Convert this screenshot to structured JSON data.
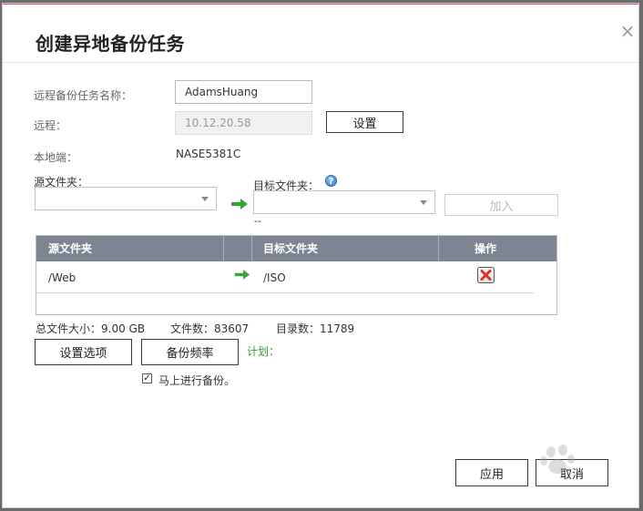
{
  "dialog": {
    "title": "创建异地备份任务",
    "close_symbol": "×"
  },
  "form": {
    "task_name_label": "远程备份任务名称：",
    "task_name_value": "AdamsHuang",
    "remote_label": "远程：",
    "remote_value": "10.12.20.58",
    "settings_button": "设置",
    "local_label": "本地端：",
    "local_value": "NASE5381C",
    "source_folder_label": "源文件夹：",
    "target_folder_label": "目标文件夹：",
    "help_symbol": "?",
    "target_note": "--",
    "add_button": "加入"
  },
  "table": {
    "headers": [
      "源文件夹",
      "目标文件夹",
      "操作"
    ],
    "rows": [
      {
        "source": "/Web",
        "target": "/ISO"
      }
    ]
  },
  "summary": {
    "total_size": "总文件大小：9.00 GB",
    "file_count": "文件数：83607",
    "dir_count": "目录数：11789"
  },
  "actions": {
    "options_button": "设置选项",
    "frequency_button": "备份频率",
    "schedule_label": "计划："
  },
  "checkbox": {
    "checked": true,
    "mark": "✓",
    "label": "马上进行备份。"
  },
  "footer": {
    "apply_button": "应用",
    "cancel_button": "取消"
  },
  "colors": {
    "header_bg": "#7d8593",
    "arrow_green": "#3aa63a",
    "delete_red": "#d9342b",
    "schedule_green": "#3a9a3a"
  }
}
